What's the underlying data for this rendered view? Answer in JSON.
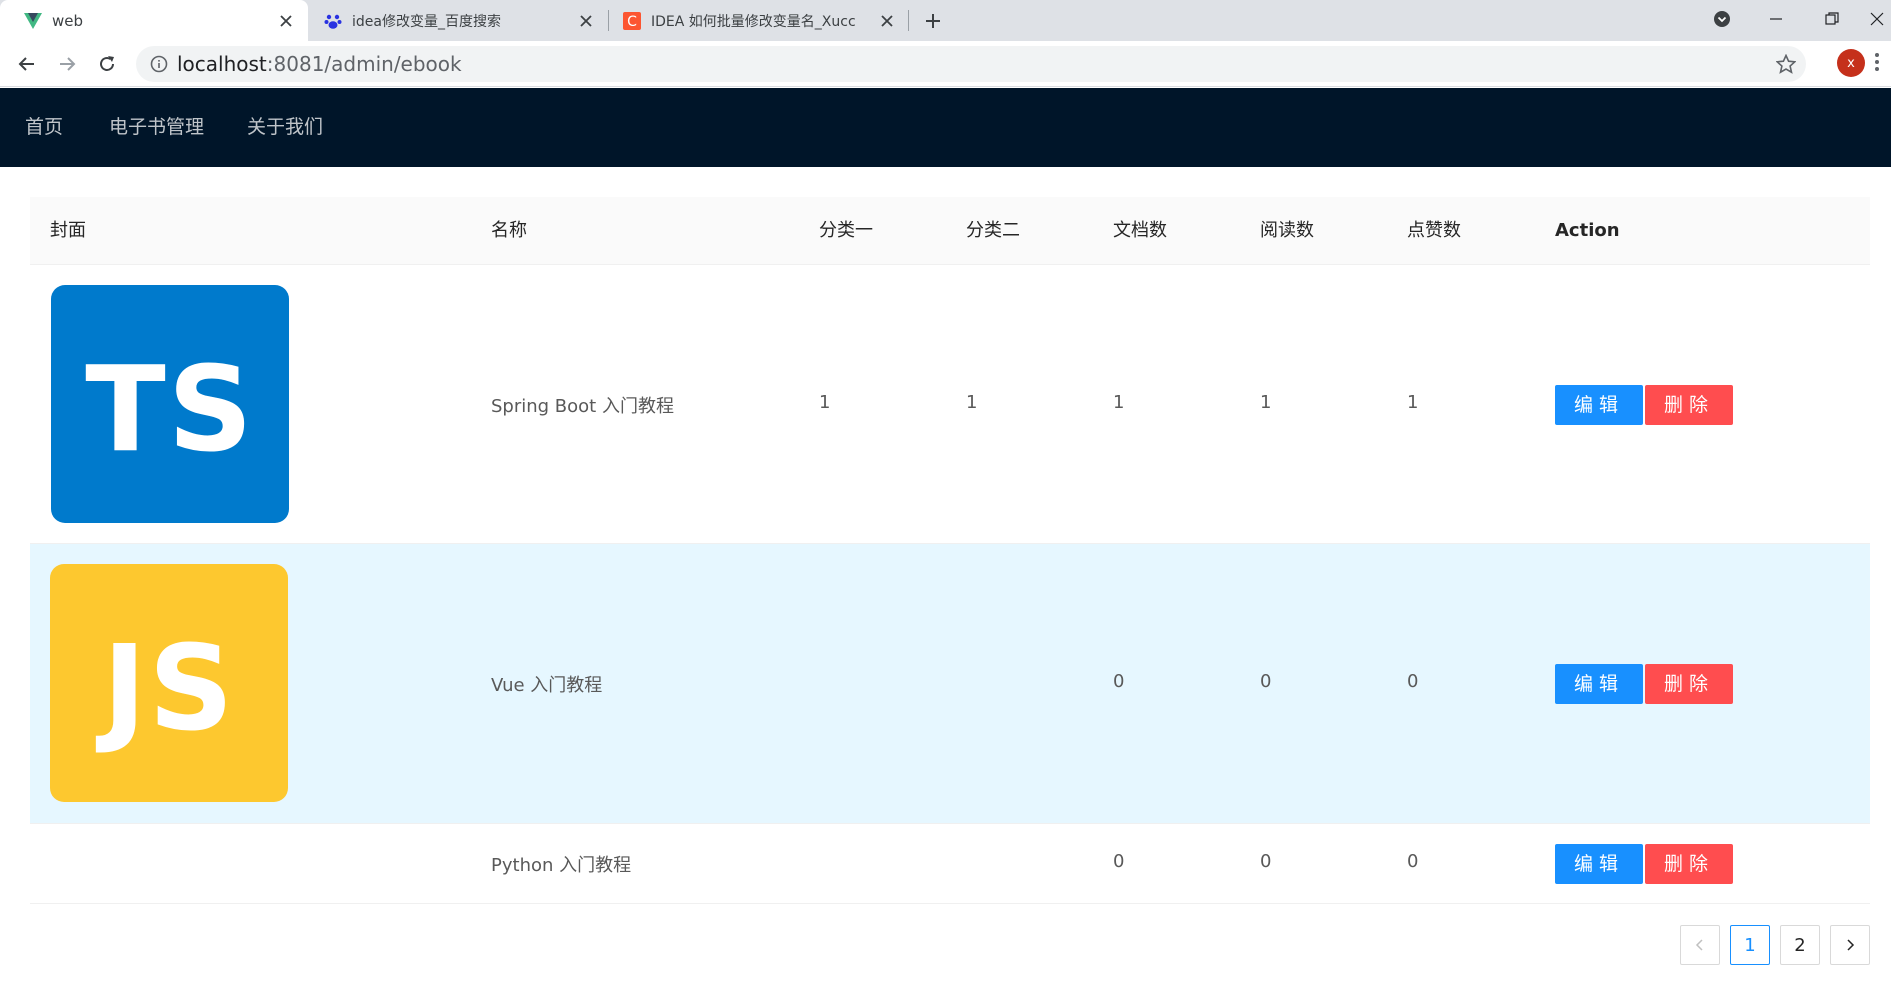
{
  "browser": {
    "tabs": [
      {
        "title": "web",
        "icon": "vue-logo-icon"
      },
      {
        "title": "idea修改变量_百度搜索",
        "icon": "baidu-paw-icon"
      },
      {
        "title": "IDEA 如何批量修改变量名_Xucc",
        "icon": "csdn-c-icon"
      }
    ],
    "address": {
      "host": "localhost",
      "path": ":8081/admin/ebook"
    },
    "profile_initial": "x"
  },
  "header": {
    "menu": [
      "首页",
      "电子书管理",
      "关于我们"
    ]
  },
  "table": {
    "columns": [
      "封面",
      "名称",
      "分类一",
      "分类二",
      "文档数",
      "阅读数",
      "点赞数",
      "Action"
    ],
    "rows": [
      {
        "cover": {
          "text": "TS",
          "color": "#007acc"
        },
        "name": "Spring Boot 入门教程",
        "category1": "1",
        "category2": "1",
        "docs": "1",
        "views": "1",
        "votes": "1"
      },
      {
        "cover": {
          "text": "JS",
          "color": "#fdc82f"
        },
        "name": "Vue 入门教程",
        "category1": "",
        "category2": "",
        "docs": "0",
        "views": "0",
        "votes": "0"
      },
      {
        "cover": null,
        "name": "Python 入门教程",
        "category1": "",
        "category2": "",
        "docs": "0",
        "views": "0",
        "votes": "0"
      }
    ],
    "actions": {
      "edit": "编辑",
      "delete": "删除"
    }
  },
  "pagination": {
    "pages": [
      "1",
      "2"
    ],
    "current": "1"
  },
  "colors": {
    "header_bg": "#001529",
    "primary": "#1890ff",
    "danger": "#ff4d4f",
    "row_hover": "#e6f7ff"
  }
}
